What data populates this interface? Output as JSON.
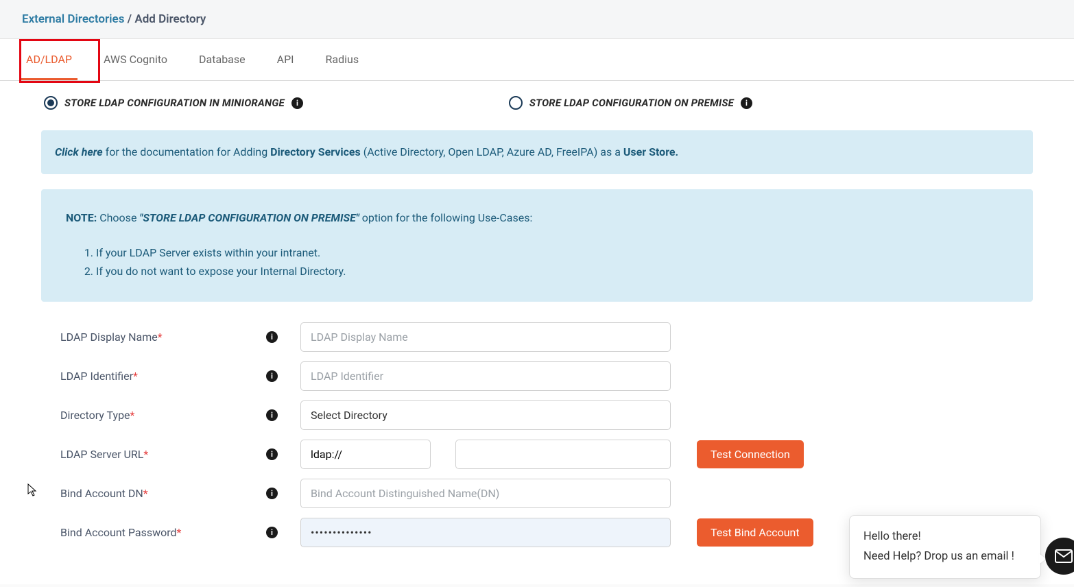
{
  "breadcrumb": {
    "link_text": "External Directories",
    "separator": " / ",
    "current": "Add Directory"
  },
  "tabs": {
    "ad_ldap": "AD/LDAP",
    "aws_cognito": "AWS Cognito",
    "database": "Database",
    "api": "API",
    "radius": "Radius"
  },
  "radios": {
    "miniorange": "STORE LDAP CONFIGURATION IN MINIORANGE",
    "onpremise": "STORE LDAP CONFIGURATION ON PREMISE"
  },
  "doc_banner": {
    "click_here": "Click here",
    "text1": " for the documentation for Adding ",
    "bold1": "Directory Services",
    "text2": " (Active Directory, Open LDAP, Azure AD, FreeIPA) as a ",
    "bold2": "User Store."
  },
  "note_box": {
    "label": "NOTE:",
    "text1": "  Choose ",
    "quoted": "\"STORE LDAP CONFIGURATION ON PREMISE\"",
    "text2": " option for the following Use-Cases:",
    "li1": "If your LDAP Server exists within your intranet.",
    "li2": "If you do not want to expose your Internal Directory."
  },
  "form": {
    "ldap_display_name": {
      "label": "LDAP Display Name",
      "placeholder": "LDAP Display Name"
    },
    "ldap_identifier": {
      "label": "LDAP Identifier",
      "placeholder": "LDAP Identifier"
    },
    "directory_type": {
      "label": "Directory Type",
      "placeholder": "Select Directory"
    },
    "ldap_server_url": {
      "label": "LDAP Server URL",
      "scheme": "ldap://"
    },
    "bind_dn": {
      "label": "Bind Account DN",
      "placeholder": "Bind Account Distinguished Name(DN)"
    },
    "bind_pw": {
      "label": "Bind Account Password",
      "value": "••••••••••••••"
    }
  },
  "buttons": {
    "test_connection": "Test Connection",
    "test_bind": "Test Bind Account"
  },
  "chat": {
    "line1": "Hello there!",
    "line2": "Need Help? Drop us an email !"
  }
}
